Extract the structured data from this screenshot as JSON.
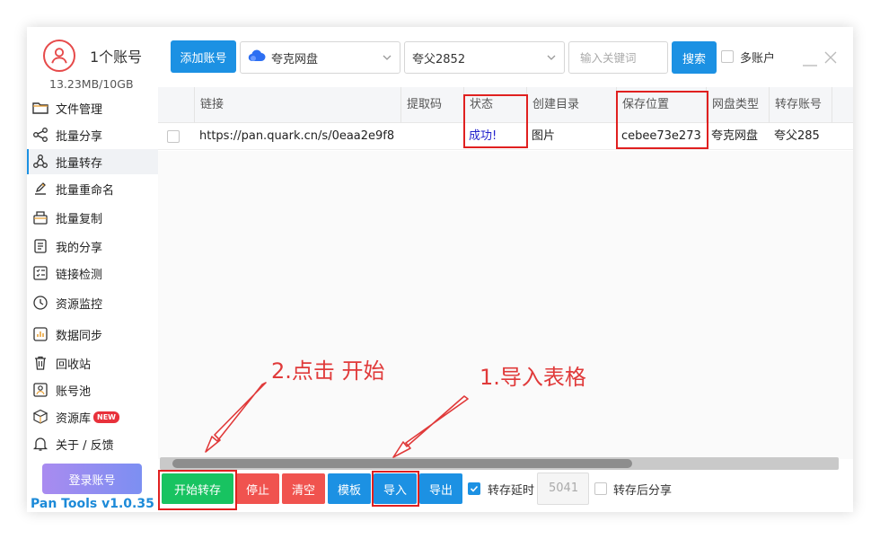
{
  "sidebar": {
    "account_title": "1个账号",
    "storage": "13.23MB/10GB",
    "items": [
      {
        "label": "文件管理",
        "icon": "folder-icon"
      },
      {
        "label": "批量分享",
        "icon": "share-icon"
      },
      {
        "label": "批量转存",
        "icon": "transfer-icon",
        "active": true
      },
      {
        "label": "批量重命名",
        "icon": "rename-icon"
      },
      {
        "label": "批量复制",
        "icon": "copy-icon"
      },
      {
        "label": "我的分享",
        "icon": "my-share-icon"
      },
      {
        "label": "链接检测",
        "icon": "link-check-icon"
      },
      {
        "label": "资源监控",
        "icon": "monitor-icon"
      },
      {
        "label": "数据同步",
        "icon": "sync-icon"
      },
      {
        "label": "回收站",
        "icon": "trash-icon"
      },
      {
        "label": "账号池",
        "icon": "account-pool-icon"
      },
      {
        "label": "资源库",
        "icon": "library-icon",
        "badge": "NEW"
      },
      {
        "label": "关于 / 反馈",
        "icon": "bell-icon"
      }
    ],
    "login_label": "登录账号",
    "version": "Pan Tools v1.0.35"
  },
  "toolbar": {
    "add_account_label": "添加账号",
    "drive_select": "夸克网盘",
    "account_select": "夸父2852",
    "search_placeholder": "输入关键词",
    "search_label": "搜索",
    "multi_account_label": "多账户"
  },
  "table": {
    "headers": [
      "链接",
      "提取码",
      "状态",
      "创建目录",
      "保存位置",
      "网盘类型",
      "转存账号"
    ],
    "rows": [
      {
        "link": "https://pan.quark.cn/s/0eaa2e9f8",
        "code": "",
        "status": "成功!",
        "dir": "图片",
        "location": "cebee73e273",
        "drive_type": "夸克网盘",
        "account": "夸父285"
      }
    ]
  },
  "bottom": {
    "start_label": "开始转存",
    "stop_label": "停止",
    "clear_label": "清空",
    "template_label": "模板",
    "import_label": "导入",
    "export_label": "导出",
    "delay_label": "转存延时",
    "delay_value": "5041",
    "share_after_label": "转存后分享"
  },
  "annotations": {
    "step1": "1.导入表格",
    "step2": "2.点击 开始"
  },
  "colors": {
    "primary": "#1c91e3",
    "green": "#18c361",
    "red": "#f0534f",
    "annotation": "#e03a3a"
  }
}
